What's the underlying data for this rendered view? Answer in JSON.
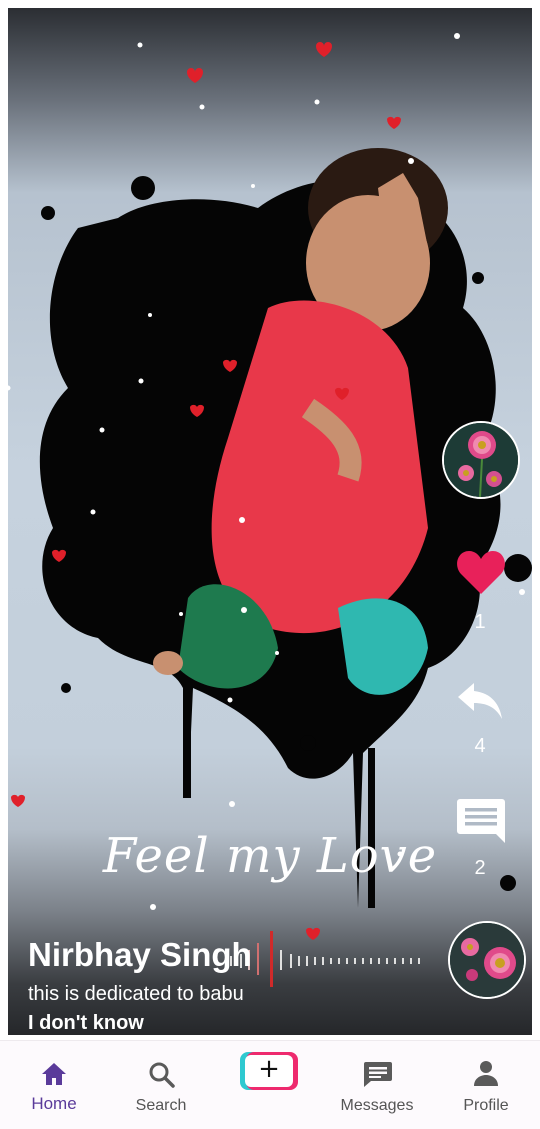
{
  "video": {
    "overlay_caption": "Feel my Love",
    "uploader_name": "Nirbhay Singh",
    "description": "this is dedicated to babu",
    "song_title": "I don't know",
    "colors": {
      "heart": "#e8215a",
      "accent": "#5a3a9a"
    }
  },
  "actions": {
    "like_count": "1",
    "share_count": "4",
    "comment_count": "2"
  },
  "nav": {
    "home_label": "Home",
    "search_label": "Search",
    "messages_label": "Messages",
    "profile_label": "Profile",
    "add_label": "+",
    "active": "Home"
  }
}
